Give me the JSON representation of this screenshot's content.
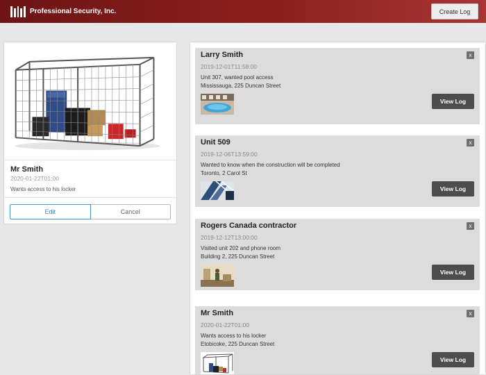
{
  "header": {
    "brand": "Professional Security, Inc.",
    "logo_icon": "pillars-logo-icon",
    "create_log_label": "Create Log"
  },
  "detail": {
    "name": "Mr Smith",
    "date": "2020-01-22T01:00",
    "description": "Wants access to his locker",
    "image_icon": "storage-locker-cage-image",
    "edit_label": "Edit",
    "cancel_label": "Cancel"
  },
  "logs": [
    {
      "title": "Larry Smith",
      "date": "2019-12-01T11:58:00",
      "description": "Unit 307, wanted pool access",
      "location": "Mississauga, 225 Duncan Street",
      "thumb": "pool-photo",
      "view_label": "View Log",
      "close": "x"
    },
    {
      "title": "Unit 509",
      "date": "2019-12-06T13:59:00",
      "description": "Wanted to know when the construction will be completed",
      "location": "Toronto, 2 Carol St",
      "thumb": "construction-photo",
      "view_label": "View Log",
      "close": "x"
    },
    {
      "title": "Rogers Canada contractor",
      "date": "2019-12-12T13:00:00",
      "description": "Visited unit 202 and phone room",
      "location": "Building 2, 225 Duncan Street",
      "thumb": "contractor-photo",
      "view_label": "View Log",
      "close": "x"
    },
    {
      "title": "Mr Smith",
      "date": "2020-01-22T01:00",
      "description": "Wants access to his locker",
      "location": "Etobicoke, 225 Duncan Street",
      "thumb": "locker-photo",
      "view_label": "View Log",
      "close": "x"
    }
  ],
  "colors": {
    "header_dark": "#6d1414",
    "header_light": "#a83535",
    "edit_blue": "#3b7fb6",
    "view_button": "#4d4d4d",
    "card_bg": "#dcdcdc"
  }
}
